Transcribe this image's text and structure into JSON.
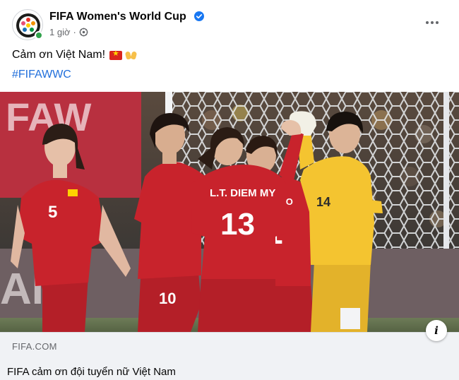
{
  "post": {
    "page_name": "FIFA Women's World Cup",
    "timestamp": "1 giờ",
    "separator": "·",
    "caption_text": "Cảm ơn Việt Nam!",
    "hashtag": "#FIFAWWC"
  },
  "photo": {
    "banner_text": "FAW",
    "bottom_banner_text": "AIR",
    "players": [
      {
        "number": "5"
      },
      {
        "number": "10"
      },
      {
        "number": "13",
        "name": "L.T. DIEM MY"
      },
      {
        "number": "1",
        "name": "THAO"
      },
      {
        "number": "14"
      }
    ]
  },
  "link_preview": {
    "domain": "FIFA.COM",
    "title": "FIFA cảm ơn đội tuyển nữ Việt Nam"
  },
  "icons": {
    "verified": "verified-badge-icon",
    "globe": "globe-icon",
    "more": "more-options-icon",
    "info": "info-icon"
  },
  "colors": {
    "verified_blue": "#1877f2",
    "hashtag_blue": "#216fdb",
    "kit_red": "#c8232c",
    "goalkeeper_yellow": "#f4c430"
  }
}
